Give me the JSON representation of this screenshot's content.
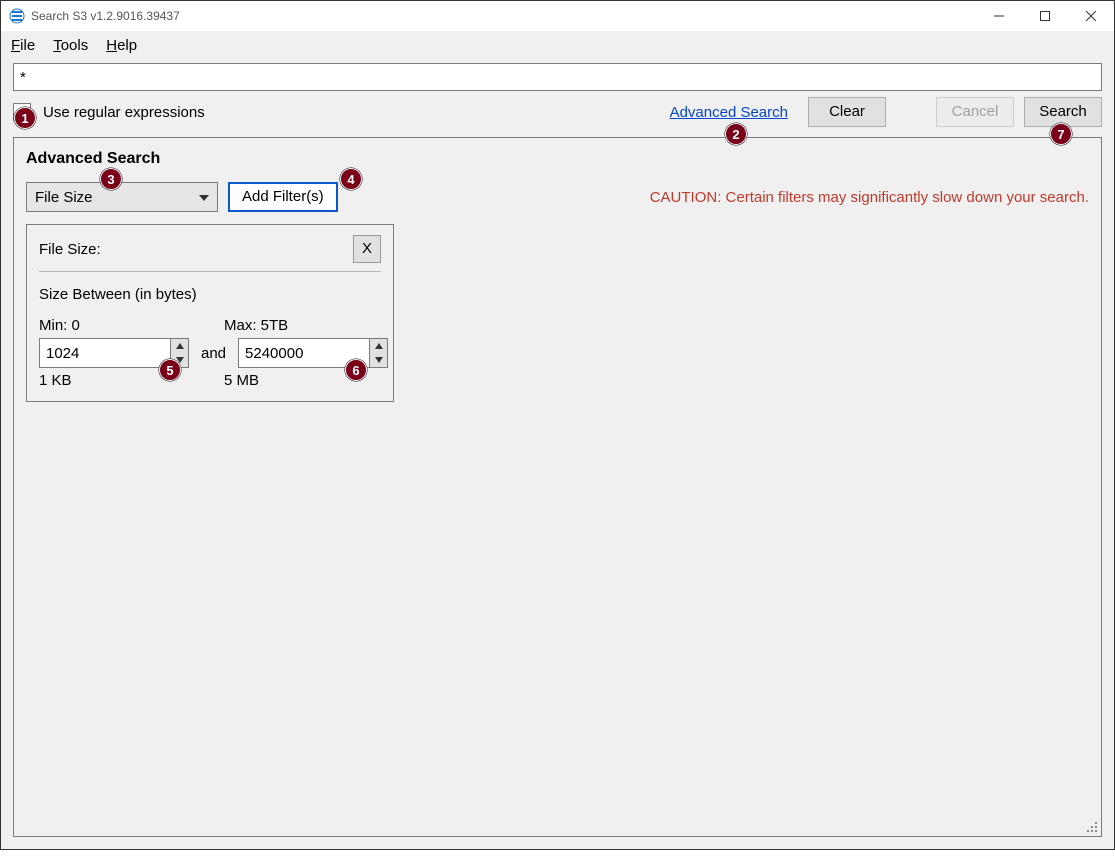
{
  "window": {
    "title": "Search S3 v1.2.9016.39437"
  },
  "menu": {
    "file": "File",
    "tools": "Tools",
    "help": "Help"
  },
  "search": {
    "value": "*",
    "regex_label": "Use regular expressions"
  },
  "toolbar": {
    "advanced_link": "Advanced Search",
    "clear": "Clear",
    "cancel": "Cancel",
    "search": "Search"
  },
  "panel": {
    "title": "Advanced Search",
    "filter_type": "File Size",
    "add_filter": "Add Filter(s)",
    "caution": "CAUTION: Certain filters may significantly slow down your search."
  },
  "filter_card": {
    "title": "File Size:",
    "close": "X",
    "subhead": "Size Between (in bytes)",
    "min_label": "Min: 0",
    "max_label": "Max: 5TB",
    "min_value": "1024",
    "max_value": "5240000",
    "and": "and",
    "min_readable": "1 KB",
    "max_readable": "5 MB"
  },
  "annotations": {
    "1": "1",
    "2": "2",
    "3": "3",
    "4": "4",
    "5": "5",
    "6": "6",
    "7": "7"
  }
}
